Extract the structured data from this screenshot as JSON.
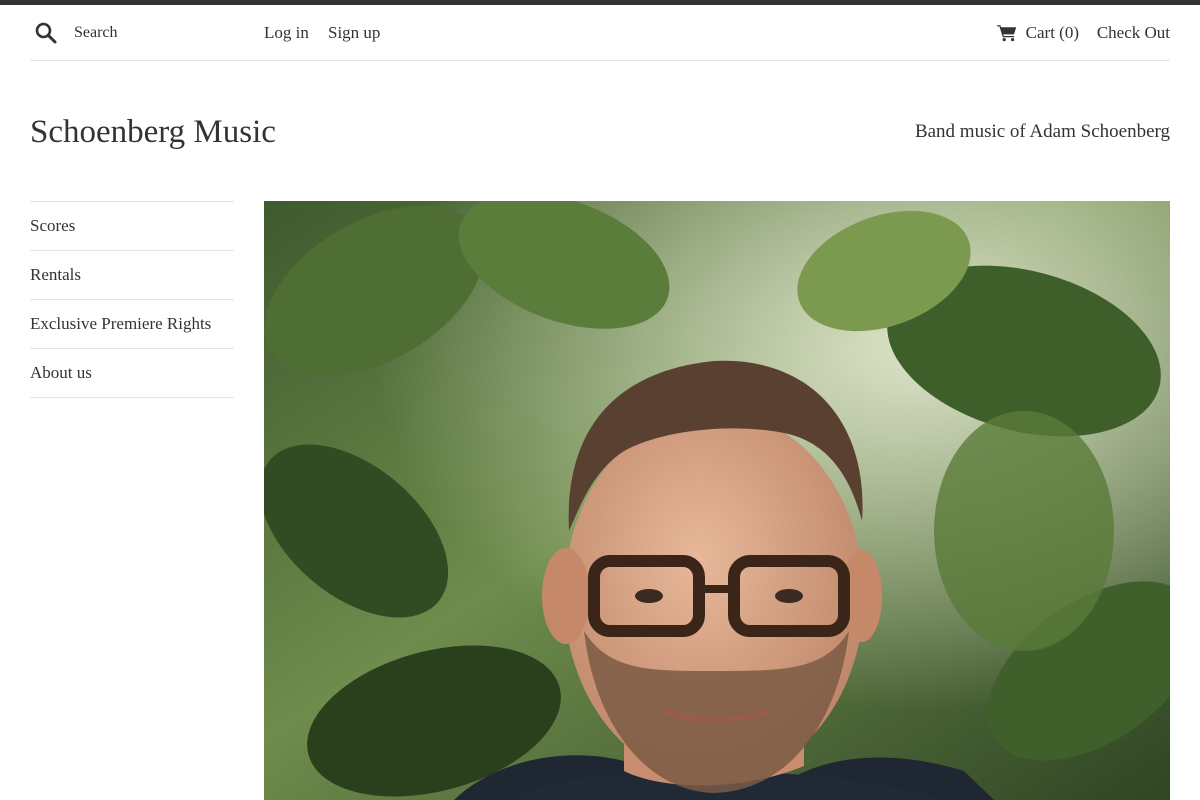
{
  "search": {
    "placeholder": "Search"
  },
  "header": {
    "login_label": "Log in",
    "signup_label": "Sign up",
    "cart_label": "Cart (0)",
    "checkout_label": "Check Out"
  },
  "site": {
    "title": "Schoenberg Music",
    "tagline": "Band music of Adam Schoenberg"
  },
  "sidebar": {
    "items": [
      {
        "label": "Scores"
      },
      {
        "label": "Rentals"
      },
      {
        "label": "Exclusive Premiere Rights"
      },
      {
        "label": "About us"
      }
    ]
  },
  "colors": {
    "text": "#333333",
    "divider": "#e5e5e5",
    "top_bar": "#333333",
    "background": "#ffffff"
  },
  "icons": {
    "search": "search-icon",
    "cart": "cart-icon"
  }
}
